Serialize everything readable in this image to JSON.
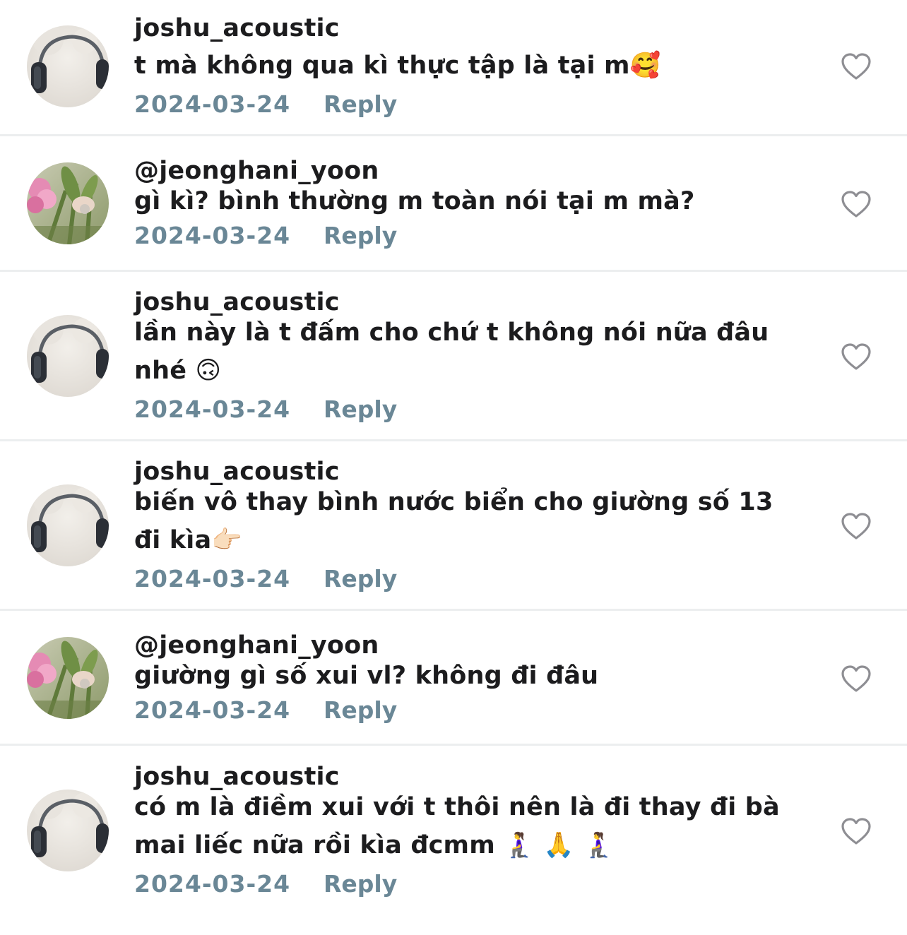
{
  "comments": [
    {
      "username": "joshu_acoustic",
      "text": "t mà không qua kì thực tập là tại m🥰",
      "date": "2024-03-24",
      "reply_label": "Reply",
      "avatar": "headphones-avatar"
    },
    {
      "username": "@jeonghani_yoon",
      "text": "gì kì? bình thường m toàn nói tại m mà?",
      "date": "2024-03-24",
      "reply_label": "Reply",
      "avatar": "flowers-avatar"
    },
    {
      "username": "joshu_acoustic",
      "text": "lần này là t đấm cho chứ t không nói nữa đâu nhé 🙃",
      "date": "2024-03-24",
      "reply_label": "Reply",
      "avatar": "headphones-avatar"
    },
    {
      "username": "joshu_acoustic",
      "text": "biến vô thay bình nước biển cho giường số 13 đi kìa👉🏻",
      "date": "2024-03-24",
      "reply_label": "Reply",
      "avatar": "headphones-avatar"
    },
    {
      "username": "@jeonghani_yoon",
      "text": "giường gì số xui vl? không đi đâu",
      "date": "2024-03-24",
      "reply_label": "Reply",
      "avatar": "flowers-avatar"
    },
    {
      "username": "joshu_acoustic",
      "text": "có m là điềm xui với t thôi nên là đi thay đi bà mai liếc nữa rồi kìa đcmm 🧎‍♀️ 🙏 🧎‍♀️",
      "date": "2024-03-24",
      "reply_label": "Reply",
      "avatar": "headphones-avatar"
    }
  ],
  "colors": {
    "text": "#1c1c1e",
    "meta": "#6a8796",
    "divider": "#eceeef",
    "heart_outline": "#8e8e93"
  },
  "icons": {
    "like": "heart-outline-icon"
  }
}
